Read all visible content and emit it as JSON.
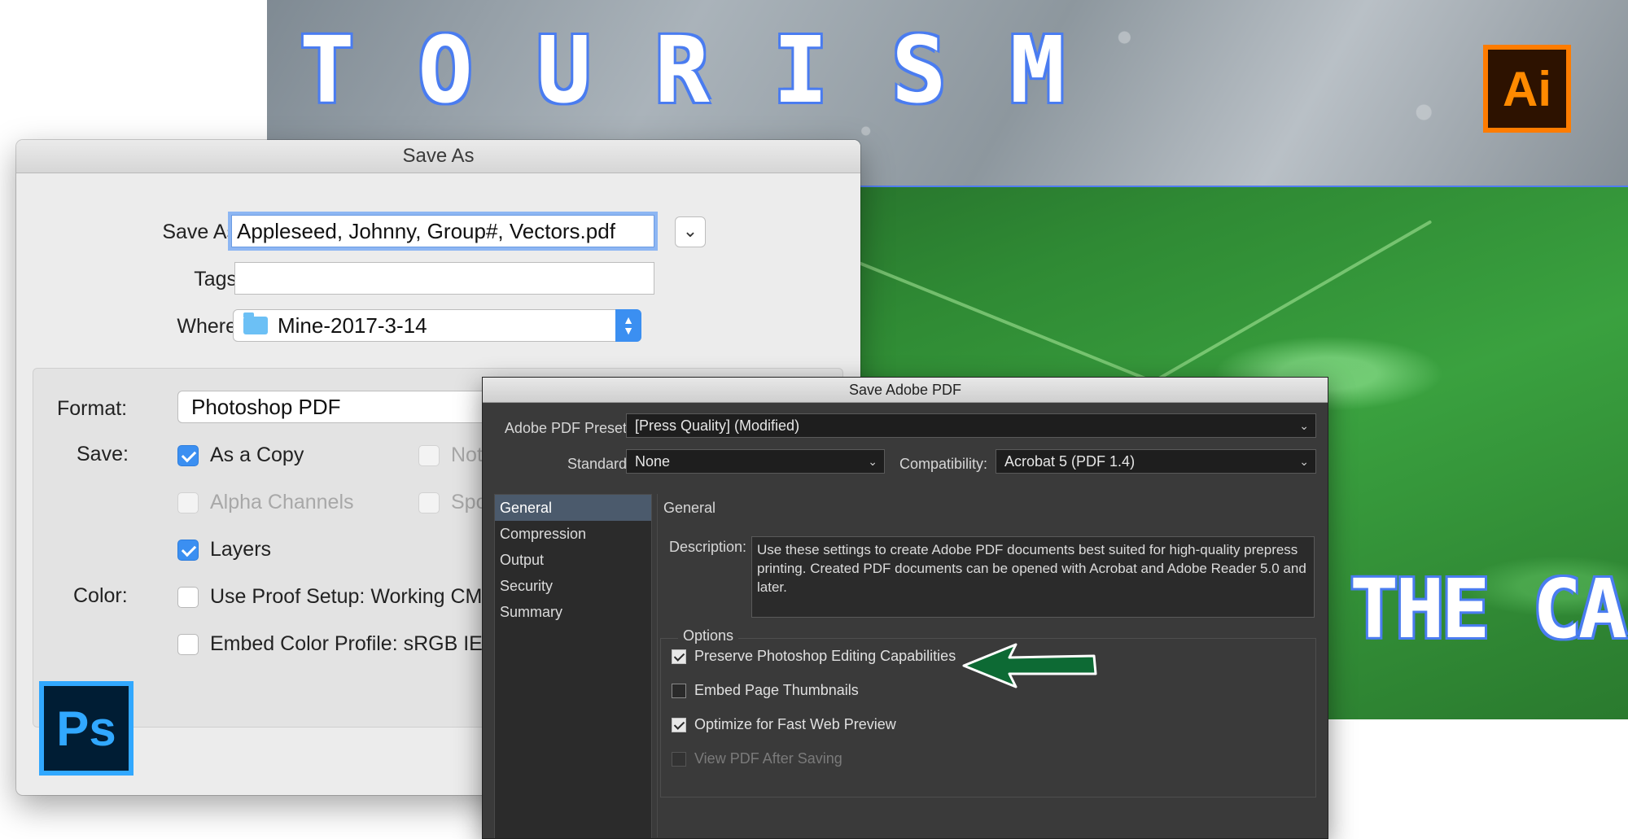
{
  "artwork": {
    "heading": "TOURISM",
    "tagline": "THE CAL",
    "illustrator_badge": "Ai",
    "photoshop_badge": "Ps"
  },
  "save_as_dialog": {
    "title": "Save As",
    "save_as_label": "Save As:",
    "filename": "Appleseed, Johnny, Group#, Vectors.pdf",
    "expand_glyph": "⌄",
    "tags_label": "Tags:",
    "tags_value": "",
    "where_label": "Where:",
    "where_value": "Mine-2017-3-14",
    "format_label": "Format:",
    "format_value": "Photoshop PDF",
    "save_label": "Save:",
    "color_label": "Color:",
    "options": {
      "as_a_copy": {
        "label": "As a Copy",
        "checked": true
      },
      "notes": {
        "label": "Not",
        "checked": false
      },
      "alpha_channels": {
        "label": "Alpha Channels",
        "checked": false
      },
      "spot": {
        "label": "Spo",
        "checked": false
      },
      "layers": {
        "label": "Layers",
        "checked": true
      },
      "use_proof_setup": {
        "label": "Use Proof Setup:  Working CM",
        "checked": false
      },
      "embed_color_profile": {
        "label": "Embed Color Profile:  sRGB IEC",
        "checked": false
      }
    }
  },
  "pdf_dialog": {
    "title": "Save Adobe PDF",
    "preset_label": "Adobe PDF Preset:",
    "preset_value": "[Press Quality] (Modified)",
    "standard_label": "Standard:",
    "standard_value": "None",
    "compat_label": "Compatibility:",
    "compat_value": "Acrobat 5 (PDF 1.4)",
    "nav": [
      "General",
      "Compression",
      "Output",
      "Security",
      "Summary"
    ],
    "section_title": "General",
    "description_label": "Description:",
    "description": "Use these settings to create Adobe PDF documents best suited for high-quality prepress printing.  Created PDF documents can be opened with Acrobat and Adobe Reader 5.0 and later.",
    "options_title": "Options",
    "options": [
      {
        "label": "Preserve Photoshop Editing Capabilities",
        "checked": true,
        "enabled": true
      },
      {
        "label": "Embed Page Thumbnails",
        "checked": false,
        "enabled": true
      },
      {
        "label": "Optimize for Fast Web Preview",
        "checked": true,
        "enabled": true
      },
      {
        "label": "View PDF After Saving",
        "checked": false,
        "enabled": false
      }
    ]
  },
  "colors": {
    "selection_blue": "#4a7cf0",
    "mac_accent": "#3b8ff1",
    "pointer_arrow": "#0d6a34",
    "ai_orange": "#ff7c00",
    "ps_blue": "#31a8ff"
  }
}
